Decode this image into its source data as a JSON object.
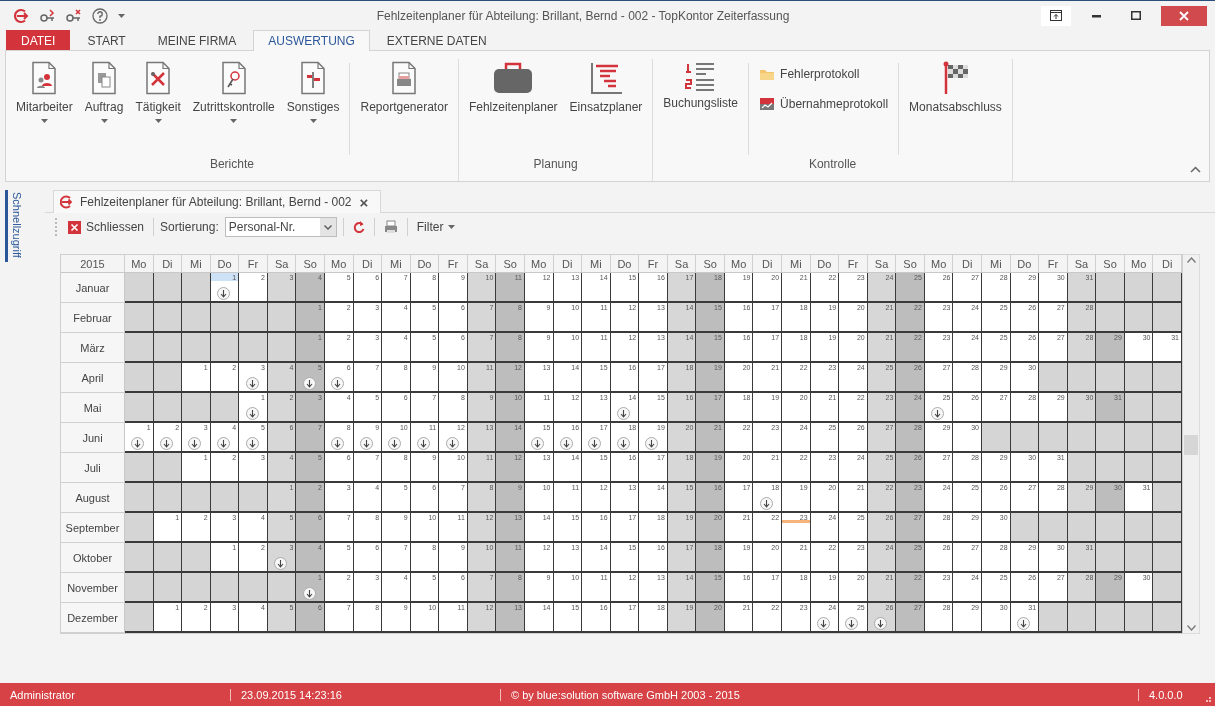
{
  "window": {
    "title": "Fehlzeitenplaner für Abteilung: Brillant, Bernd - 002 - TopKontor Zeiterfassung"
  },
  "ribbon": {
    "tabs": [
      {
        "label": "DATEI",
        "kind": "file",
        "selected": false
      },
      {
        "label": "START",
        "kind": "tab",
        "selected": false
      },
      {
        "label": "MEINE FIRMA",
        "kind": "tab",
        "selected": false
      },
      {
        "label": "AUSWERTUNG",
        "kind": "tab",
        "selected": true
      },
      {
        "label": "EXTERNE DATEN",
        "kind": "tab",
        "selected": false
      }
    ],
    "groups": [
      {
        "label": "Berichte",
        "items": [
          {
            "label": "Mitarbeiter",
            "kind": "dropdown"
          },
          {
            "label": "Auftrag",
            "kind": "dropdown"
          },
          {
            "label": "Tätigkeit",
            "kind": "dropdown"
          },
          {
            "label": "Zutrittskontrolle",
            "kind": "dropdown"
          },
          {
            "label": "Sonstiges",
            "kind": "dropdown"
          },
          {
            "label": "Reportgenerator",
            "kind": "large"
          }
        ]
      },
      {
        "label": "Planung",
        "items": [
          {
            "label": "Fehlzeitenplaner",
            "kind": "large"
          },
          {
            "label": "Einsatzplaner",
            "kind": "large"
          }
        ]
      },
      {
        "label": "Kontrolle",
        "items": [
          {
            "label": "Buchungsliste",
            "kind": "large"
          },
          {
            "label": "Fehlerprotokoll",
            "kind": "small"
          },
          {
            "label": "Übernahmeprotokoll",
            "kind": "small"
          },
          {
            "label": "Monatsabschluss",
            "kind": "large"
          }
        ]
      }
    ]
  },
  "sidebar": {
    "label": "Schnellzugriff"
  },
  "document_tab": {
    "title": "Fehlzeitenplaner für Abteilung: Brillant, Bernd - 002",
    "close": "×"
  },
  "toolbar": {
    "close_button": "Schliessen",
    "sort_label": "Sortierung:",
    "sort_value": "Personal-Nr.",
    "filter_button": "Filter"
  },
  "calendar": {
    "year": "2015",
    "weekdays": [
      "Mo",
      "Di",
      "Mi",
      "Do",
      "Fr",
      "Sa",
      "So",
      "Mo",
      "Di",
      "Mi",
      "Do",
      "Fr",
      "Sa",
      "So",
      "Mo",
      "Di",
      "Mi",
      "Do",
      "Fr",
      "Sa",
      "So",
      "Mo",
      "Di",
      "Mi",
      "Do",
      "Fr",
      "Sa",
      "So",
      "Mo",
      "Di",
      "Mi",
      "Do",
      "Fr",
      "Sa",
      "So",
      "Mo",
      "Di"
    ],
    "months": [
      {
        "name": "Januar",
        "leading_blanks": [
          {
            "kind": "blank"
          },
          {
            "kind": "blank"
          },
          {
            "kind": "blank"
          }
        ],
        "days": [
          {
            "day": "1",
            "marked": true,
            "selected": true
          },
          {
            "day": "2",
            "marked": false
          },
          {
            "day": "3",
            "marked": false
          },
          {
            "day": "4",
            "marked": false
          },
          {
            "day": "5",
            "marked": false
          },
          {
            "day": "6",
            "marked": false
          },
          {
            "day": "7",
            "marked": false
          },
          {
            "day": "8",
            "marked": false
          },
          {
            "day": "9",
            "marked": false
          },
          {
            "day": "10",
            "marked": false
          },
          {
            "day": "11",
            "marked": false
          },
          {
            "day": "12",
            "marked": false
          },
          {
            "day": "13",
            "marked": false
          },
          {
            "day": "14",
            "marked": false
          },
          {
            "day": "15",
            "marked": false
          },
          {
            "day": "16",
            "marked": false
          },
          {
            "day": "17",
            "marked": false
          },
          {
            "day": "18",
            "marked": false
          },
          {
            "day": "19",
            "marked": false
          },
          {
            "day": "20",
            "marked": false
          },
          {
            "day": "21",
            "marked": false
          },
          {
            "day": "22",
            "marked": false
          },
          {
            "day": "23",
            "marked": false
          },
          {
            "day": "24",
            "marked": false
          },
          {
            "day": "25",
            "marked": false
          },
          {
            "day": "26",
            "marked": false
          },
          {
            "day": "27",
            "marked": false
          },
          {
            "day": "28",
            "marked": false
          },
          {
            "day": "29",
            "marked": false
          },
          {
            "day": "30",
            "marked": false
          },
          {
            "day": "31",
            "marked": false
          }
        ]
      },
      {
        "name": "Februar",
        "leading_blanks": [
          {
            "kind": "blank"
          },
          {
            "kind": "blank"
          },
          {
            "kind": "blank"
          },
          {
            "kind": "blank"
          },
          {
            "kind": "blank"
          },
          {
            "kind": "blank"
          }
        ],
        "days": [
          {
            "day": "1",
            "marked": false
          },
          {
            "day": "2",
            "marked": false
          },
          {
            "day": "3",
            "marked": false
          },
          {
            "day": "4",
            "marked": false
          },
          {
            "day": "5",
            "marked": false
          },
          {
            "day": "6",
            "marked": false
          },
          {
            "day": "7",
            "marked": false
          },
          {
            "day": "8",
            "marked": false
          },
          {
            "day": "9",
            "marked": false
          },
          {
            "day": "10",
            "marked": false
          },
          {
            "day": "11",
            "marked": false
          },
          {
            "day": "12",
            "marked": false
          },
          {
            "day": "13",
            "marked": false
          },
          {
            "day": "14",
            "marked": false
          },
          {
            "day": "15",
            "marked": false
          },
          {
            "day": "16",
            "marked": false
          },
          {
            "day": "17",
            "marked": false
          },
          {
            "day": "18",
            "marked": false
          },
          {
            "day": "19",
            "marked": false
          },
          {
            "day": "20",
            "marked": false
          },
          {
            "day": "21",
            "marked": false
          },
          {
            "day": "22",
            "marked": false
          },
          {
            "day": "23",
            "marked": false
          },
          {
            "day": "24",
            "marked": false
          },
          {
            "day": "25",
            "marked": false
          },
          {
            "day": "26",
            "marked": false
          },
          {
            "day": "27",
            "marked": false
          },
          {
            "day": "28",
            "marked": false
          }
        ]
      },
      {
        "name": "März",
        "leading_blanks": [
          {
            "kind": "blank"
          },
          {
            "kind": "blank"
          },
          {
            "kind": "blank"
          },
          {
            "kind": "blank"
          },
          {
            "kind": "blank"
          },
          {
            "kind": "blank"
          }
        ],
        "days": [
          {
            "day": "1",
            "marked": false
          },
          {
            "day": "2",
            "marked": false
          },
          {
            "day": "3",
            "marked": false
          },
          {
            "day": "4",
            "marked": false
          },
          {
            "day": "5",
            "marked": false
          },
          {
            "day": "6",
            "marked": false
          },
          {
            "day": "7",
            "marked": false
          },
          {
            "day": "8",
            "marked": false
          },
          {
            "day": "9",
            "marked": false
          },
          {
            "day": "10",
            "marked": false
          },
          {
            "day": "11",
            "marked": false
          },
          {
            "day": "12",
            "marked": false
          },
          {
            "day": "13",
            "marked": false
          },
          {
            "day": "14",
            "marked": false
          },
          {
            "day": "15",
            "marked": false
          },
          {
            "day": "16",
            "marked": false
          },
          {
            "day": "17",
            "marked": false
          },
          {
            "day": "18",
            "marked": false
          },
          {
            "day": "19",
            "marked": false
          },
          {
            "day": "20",
            "marked": false
          },
          {
            "day": "21",
            "marked": false
          },
          {
            "day": "22",
            "marked": false
          },
          {
            "day": "23",
            "marked": false
          },
          {
            "day": "24",
            "marked": false
          },
          {
            "day": "25",
            "marked": false
          },
          {
            "day": "26",
            "marked": false
          },
          {
            "day": "27",
            "marked": false
          },
          {
            "day": "28",
            "marked": false
          },
          {
            "day": "29",
            "marked": false
          },
          {
            "day": "30",
            "marked": false
          },
          {
            "day": "31",
            "marked": false
          }
        ]
      },
      {
        "name": "April",
        "leading_blanks": [
          {
            "kind": "blank"
          },
          {
            "kind": "blank"
          }
        ],
        "days": [
          {
            "day": "1",
            "marked": false
          },
          {
            "day": "2",
            "marked": false
          },
          {
            "day": "3",
            "marked": true
          },
          {
            "day": "4",
            "marked": false
          },
          {
            "day": "5",
            "marked": true
          },
          {
            "day": "6",
            "marked": true
          },
          {
            "day": "7",
            "marked": false
          },
          {
            "day": "8",
            "marked": false
          },
          {
            "day": "9",
            "marked": false
          },
          {
            "day": "10",
            "marked": false
          },
          {
            "day": "11",
            "marked": false
          },
          {
            "day": "12",
            "marked": false
          },
          {
            "day": "13",
            "marked": false
          },
          {
            "day": "14",
            "marked": false
          },
          {
            "day": "15",
            "marked": false
          },
          {
            "day": "16",
            "marked": false
          },
          {
            "day": "17",
            "marked": false
          },
          {
            "day": "18",
            "marked": false
          },
          {
            "day": "19",
            "marked": false
          },
          {
            "day": "20",
            "marked": false
          },
          {
            "day": "21",
            "marked": false
          },
          {
            "day": "22",
            "marked": false
          },
          {
            "day": "23",
            "marked": false
          },
          {
            "day": "24",
            "marked": false
          },
          {
            "day": "25",
            "marked": false
          },
          {
            "day": "26",
            "marked": false
          },
          {
            "day": "27",
            "marked": false
          },
          {
            "day": "28",
            "marked": false
          },
          {
            "day": "29",
            "marked": false
          },
          {
            "day": "30",
            "marked": false
          }
        ]
      },
      {
        "name": "Mai",
        "leading_blanks": [
          {
            "kind": "blank"
          },
          {
            "kind": "blank"
          },
          {
            "kind": "blank"
          },
          {
            "kind": "blank"
          }
        ],
        "days": [
          {
            "day": "1",
            "marked": true
          },
          {
            "day": "2",
            "marked": false
          },
          {
            "day": "3",
            "marked": false
          },
          {
            "day": "4",
            "marked": false
          },
          {
            "day": "5",
            "marked": false
          },
          {
            "day": "6",
            "marked": false
          },
          {
            "day": "7",
            "marked": false
          },
          {
            "day": "8",
            "marked": false
          },
          {
            "day": "9",
            "marked": false
          },
          {
            "day": "10",
            "marked": false
          },
          {
            "day": "11",
            "marked": false
          },
          {
            "day": "12",
            "marked": false
          },
          {
            "day": "13",
            "marked": false
          },
          {
            "day": "14",
            "marked": true
          },
          {
            "day": "15",
            "marked": false
          },
          {
            "day": "16",
            "marked": false
          },
          {
            "day": "17",
            "marked": false
          },
          {
            "day": "18",
            "marked": false
          },
          {
            "day": "19",
            "marked": false
          },
          {
            "day": "20",
            "marked": false
          },
          {
            "day": "21",
            "marked": false
          },
          {
            "day": "22",
            "marked": false
          },
          {
            "day": "23",
            "marked": false
          },
          {
            "day": "24",
            "marked": false
          },
          {
            "day": "25",
            "marked": true
          },
          {
            "day": "26",
            "marked": false
          },
          {
            "day": "27",
            "marked": false
          },
          {
            "day": "28",
            "marked": false
          },
          {
            "day": "29",
            "marked": false
          },
          {
            "day": "30",
            "marked": false
          },
          {
            "day": "31",
            "marked": false
          }
        ]
      },
      {
        "name": "Juni",
        "days": [
          {
            "day": "1",
            "marked": true
          },
          {
            "day": "2",
            "marked": true
          },
          {
            "day": "3",
            "marked": true
          },
          {
            "day": "4",
            "marked": true
          },
          {
            "day": "5",
            "marked": true
          },
          {
            "day": "6",
            "marked": false
          },
          {
            "day": "7",
            "marked": false
          },
          {
            "day": "8",
            "marked": true
          },
          {
            "day": "9",
            "marked": true
          },
          {
            "day": "10",
            "marked": true
          },
          {
            "day": "11",
            "marked": true
          },
          {
            "day": "12",
            "marked": true
          },
          {
            "day": "13",
            "marked": false
          },
          {
            "day": "14",
            "marked": false
          },
          {
            "day": "15",
            "marked": true
          },
          {
            "day": "16",
            "marked": true
          },
          {
            "day": "17",
            "marked": true
          },
          {
            "day": "18",
            "marked": true
          },
          {
            "day": "19",
            "marked": true
          },
          {
            "day": "20",
            "marked": false
          },
          {
            "day": "21",
            "marked": false
          },
          {
            "day": "22",
            "marked": false
          },
          {
            "day": "23",
            "marked": false
          },
          {
            "day": "24",
            "marked": false
          },
          {
            "day": "25",
            "marked": false
          },
          {
            "day": "26",
            "marked": false
          },
          {
            "day": "27",
            "marked": false
          },
          {
            "day": "28",
            "marked": false
          },
          {
            "day": "29",
            "marked": false
          },
          {
            "day": "30",
            "marked": false
          }
        ]
      },
      {
        "name": "Juli",
        "leading_blanks": [
          {
            "kind": "blank"
          },
          {
            "kind": "blank"
          }
        ],
        "days": [
          {
            "day": "1",
            "marked": false
          },
          {
            "day": "2",
            "marked": false
          },
          {
            "day": "3",
            "marked": false
          },
          {
            "day": "4",
            "marked": false
          },
          {
            "day": "5",
            "marked": false
          },
          {
            "day": "6",
            "marked": false
          },
          {
            "day": "7",
            "marked": false
          },
          {
            "day": "8",
            "marked": false
          },
          {
            "day": "9",
            "marked": false
          },
          {
            "day": "10",
            "marked": false
          },
          {
            "day": "11",
            "marked": false
          },
          {
            "day": "12",
            "marked": false
          },
          {
            "day": "13",
            "marked": false
          },
          {
            "day": "14",
            "marked": false
          },
          {
            "day": "15",
            "marked": false
          },
          {
            "day": "16",
            "marked": false
          },
          {
            "day": "17",
            "marked": false
          },
          {
            "day": "18",
            "marked": false
          },
          {
            "day": "19",
            "marked": false
          },
          {
            "day": "20",
            "marked": false
          },
          {
            "day": "21",
            "marked": false
          },
          {
            "day": "22",
            "marked": false
          },
          {
            "day": "23",
            "marked": false
          },
          {
            "day": "24",
            "marked": false
          },
          {
            "day": "25",
            "marked": false
          },
          {
            "day": "26",
            "marked": false
          },
          {
            "day": "27",
            "marked": false
          },
          {
            "day": "28",
            "marked": false
          },
          {
            "day": "29",
            "marked": false
          },
          {
            "day": "30",
            "marked": false
          },
          {
            "day": "31",
            "marked": false
          }
        ]
      },
      {
        "name": "August",
        "leading_blanks": [
          {
            "kind": "blank"
          },
          {
            "kind": "blank"
          },
          {
            "kind": "blank"
          },
          {
            "kind": "blank"
          },
          {
            "kind": "blank"
          }
        ],
        "days": [
          {
            "day": "1",
            "marked": false
          },
          {
            "day": "2",
            "marked": false
          },
          {
            "day": "3",
            "marked": false
          },
          {
            "day": "4",
            "marked": false
          },
          {
            "day": "5",
            "marked": false
          },
          {
            "day": "6",
            "marked": false
          },
          {
            "day": "7",
            "marked": false
          },
          {
            "day": "8",
            "marked": false
          },
          {
            "day": "9",
            "marked": false
          },
          {
            "day": "10",
            "marked": false
          },
          {
            "day": "11",
            "marked": false
          },
          {
            "day": "12",
            "marked": false
          },
          {
            "day": "13",
            "marked": false
          },
          {
            "day": "14",
            "marked": false
          },
          {
            "day": "15",
            "marked": false
          },
          {
            "day": "16",
            "marked": false
          },
          {
            "day": "17",
            "marked": false
          },
          {
            "day": "18",
            "marked": true
          },
          {
            "day": "19",
            "marked": false
          },
          {
            "day": "20",
            "marked": false
          },
          {
            "day": "21",
            "marked": false
          },
          {
            "day": "22",
            "marked": false
          },
          {
            "day": "23",
            "marked": false
          },
          {
            "day": "24",
            "marked": false
          },
          {
            "day": "25",
            "marked": false
          },
          {
            "day": "26",
            "marked": false
          },
          {
            "day": "27",
            "marked": false
          },
          {
            "day": "28",
            "marked": false
          },
          {
            "day": "29",
            "marked": false
          },
          {
            "day": "30",
            "marked": false
          },
          {
            "day": "31",
            "marked": false
          }
        ]
      },
      {
        "name": "September",
        "leading_blanks": [
          {
            "kind": "blank"
          }
        ],
        "days": [
          {
            "day": "1",
            "marked": false
          },
          {
            "day": "2",
            "marked": false
          },
          {
            "day": "3",
            "marked": false
          },
          {
            "day": "4",
            "marked": false
          },
          {
            "day": "5",
            "marked": false
          },
          {
            "day": "6",
            "marked": false
          },
          {
            "day": "7",
            "marked": false
          },
          {
            "day": "8",
            "marked": false
          },
          {
            "day": "9",
            "marked": false
          },
          {
            "day": "10",
            "marked": false
          },
          {
            "day": "11",
            "marked": false
          },
          {
            "day": "12",
            "marked": false
          },
          {
            "day": "13",
            "marked": false
          },
          {
            "day": "14",
            "marked": false
          },
          {
            "day": "15",
            "marked": false
          },
          {
            "day": "16",
            "marked": false
          },
          {
            "day": "17",
            "marked": false
          },
          {
            "day": "18",
            "marked": false
          },
          {
            "day": "19",
            "marked": false
          },
          {
            "day": "20",
            "marked": false
          },
          {
            "day": "21",
            "marked": false
          },
          {
            "day": "22",
            "marked": false
          },
          {
            "day": "23",
            "marked": false,
            "today": true
          },
          {
            "day": "24",
            "marked": false
          },
          {
            "day": "25",
            "marked": false
          },
          {
            "day": "26",
            "marked": false
          },
          {
            "day": "27",
            "marked": false
          },
          {
            "day": "28",
            "marked": false
          },
          {
            "day": "29",
            "marked": false
          },
          {
            "day": "30",
            "marked": false
          }
        ]
      },
      {
        "name": "Oktober",
        "leading_blanks": [
          {
            "kind": "blank"
          },
          {
            "kind": "blank"
          },
          {
            "kind": "blank"
          }
        ],
        "days": [
          {
            "day": "1",
            "marked": false
          },
          {
            "day": "2",
            "marked": false
          },
          {
            "day": "3",
            "marked": true
          },
          {
            "day": "4",
            "marked": false
          },
          {
            "day": "5",
            "marked": false
          },
          {
            "day": "6",
            "marked": false
          },
          {
            "day": "7",
            "marked": false
          },
          {
            "day": "8",
            "marked": false
          },
          {
            "day": "9",
            "marked": false
          },
          {
            "day": "10",
            "marked": false
          },
          {
            "day": "11",
            "marked": false
          },
          {
            "day": "12",
            "marked": false
          },
          {
            "day": "13",
            "marked": false
          },
          {
            "day": "14",
            "marked": false
          },
          {
            "day": "15",
            "marked": false
          },
          {
            "day": "16",
            "marked": false
          },
          {
            "day": "17",
            "marked": false
          },
          {
            "day": "18",
            "marked": false
          },
          {
            "day": "19",
            "marked": false
          },
          {
            "day": "20",
            "marked": false
          },
          {
            "day": "21",
            "marked": false
          },
          {
            "day": "22",
            "marked": false
          },
          {
            "day": "23",
            "marked": false
          },
          {
            "day": "24",
            "marked": false
          },
          {
            "day": "25",
            "marked": false
          },
          {
            "day": "26",
            "marked": false
          },
          {
            "day": "27",
            "marked": false
          },
          {
            "day": "28",
            "marked": false
          },
          {
            "day": "29",
            "marked": false
          },
          {
            "day": "30",
            "marked": false
          },
          {
            "day": "31",
            "marked": false
          }
        ]
      },
      {
        "name": "November",
        "leading_blanks": [
          {
            "kind": "blank"
          },
          {
            "kind": "blank"
          },
          {
            "kind": "blank"
          },
          {
            "kind": "blank"
          },
          {
            "kind": "blank"
          },
          {
            "kind": "blank"
          }
        ],
        "days": [
          {
            "day": "1",
            "marked": true
          },
          {
            "day": "2",
            "marked": false
          },
          {
            "day": "3",
            "marked": false
          },
          {
            "day": "4",
            "marked": false
          },
          {
            "day": "5",
            "marked": false
          },
          {
            "day": "6",
            "marked": false
          },
          {
            "day": "7",
            "marked": false
          },
          {
            "day": "8",
            "marked": false
          },
          {
            "day": "9",
            "marked": false
          },
          {
            "day": "10",
            "marked": false
          },
          {
            "day": "11",
            "marked": false
          },
          {
            "day": "12",
            "marked": false
          },
          {
            "day": "13",
            "marked": false
          },
          {
            "day": "14",
            "marked": false
          },
          {
            "day": "15",
            "marked": false
          },
          {
            "day": "16",
            "marked": false
          },
          {
            "day": "17",
            "marked": false
          },
          {
            "day": "18",
            "marked": false
          },
          {
            "day": "19",
            "marked": false
          },
          {
            "day": "20",
            "marked": false
          },
          {
            "day": "21",
            "marked": false
          },
          {
            "day": "22",
            "marked": false
          },
          {
            "day": "23",
            "marked": false
          },
          {
            "day": "24",
            "marked": false
          },
          {
            "day": "25",
            "marked": false
          },
          {
            "day": "26",
            "marked": false
          },
          {
            "day": "27",
            "marked": false
          },
          {
            "day": "28",
            "marked": false
          },
          {
            "day": "29",
            "marked": false
          },
          {
            "day": "30",
            "marked": false
          }
        ]
      },
      {
        "name": "Dezember",
        "leading_blanks": [
          {
            "kind": "blank"
          }
        ],
        "days": [
          {
            "day": "1",
            "marked": false
          },
          {
            "day": "2",
            "marked": false
          },
          {
            "day": "3",
            "marked": false
          },
          {
            "day": "4",
            "marked": false
          },
          {
            "day": "5",
            "marked": false
          },
          {
            "day": "6",
            "marked": false
          },
          {
            "day": "7",
            "marked": false
          },
          {
            "day": "8",
            "marked": false
          },
          {
            "day": "9",
            "marked": false
          },
          {
            "day": "10",
            "marked": false
          },
          {
            "day": "11",
            "marked": false
          },
          {
            "day": "12",
            "marked": false
          },
          {
            "day": "13",
            "marked": false
          },
          {
            "day": "14",
            "marked": false
          },
          {
            "day": "15",
            "marked": false
          },
          {
            "day": "16",
            "marked": false
          },
          {
            "day": "17",
            "marked": false
          },
          {
            "day": "18",
            "marked": false
          },
          {
            "day": "19",
            "marked": false
          },
          {
            "day": "20",
            "marked": false
          },
          {
            "day": "21",
            "marked": false
          },
          {
            "day": "22",
            "marked": false
          },
          {
            "day": "23",
            "marked": false
          },
          {
            "day": "24",
            "marked": true
          },
          {
            "day": "25",
            "marked": true
          },
          {
            "day": "26",
            "marked": true
          },
          {
            "day": "27",
            "marked": false
          },
          {
            "day": "28",
            "marked": false
          },
          {
            "day": "29",
            "marked": false
          },
          {
            "day": "30",
            "marked": false
          },
          {
            "day": "31",
            "marked": true
          }
        ]
      }
    ]
  },
  "status_bar": [
    "Administrator",
    "23.09.2015 14:23:16",
    "© by blue:solution software GmbH 2003 - 2015",
    "4.0.0.0"
  ]
}
